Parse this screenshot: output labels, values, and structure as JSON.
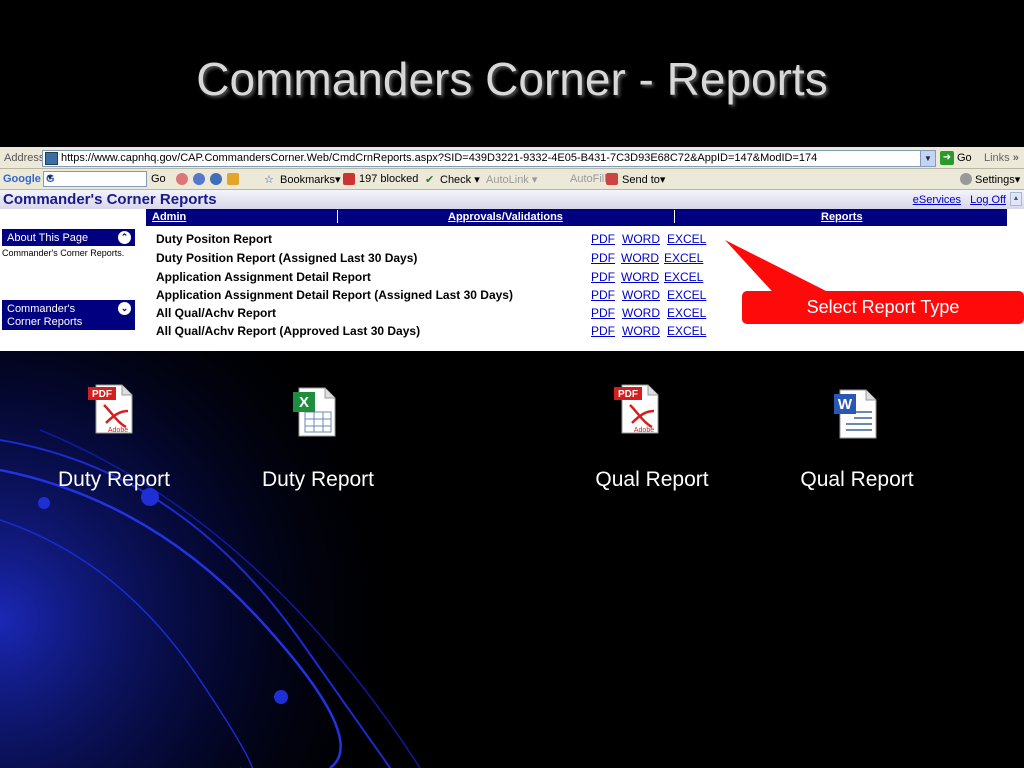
{
  "slide": {
    "title": "Commanders Corner - Reports"
  },
  "browser": {
    "address_label": "Address",
    "url": "https://www.capnhq.gov/CAP.CommandersCorner.Web/CmdCrnReports.aspx?SID=439D3221-9332-4E05-B431-7C3D93E68C72&AppID=147&ModID=174",
    "go_label": "Go",
    "links_label": "Links",
    "more_chevron": "»"
  },
  "toolbar": {
    "google_logo": "Google",
    "google_box": "G",
    "go_label": "Go",
    "bookmarks_label": "Bookmarks",
    "blocked_label": "197 blocked",
    "check_label": "Check",
    "autolink_label": "AutoLink",
    "autofill_label": "AutoFill",
    "sendto_label": "Send to",
    "settings_label": "Settings"
  },
  "app": {
    "title": "Commander's Corner Reports",
    "eservices_label": "eServices",
    "logoff_label": "Log Off"
  },
  "nav": {
    "admin": "Admin",
    "approvals": "Approvals/Validations",
    "reports": "Reports"
  },
  "sidebar": {
    "about_label": "About This Page",
    "note": "Commander's Corner Reports.",
    "menu_line1": "Commander's",
    "menu_line2": "Corner Reports"
  },
  "reports": {
    "pdf_label": "PDF",
    "word_label": "WORD",
    "excel_label": "EXCEL",
    "items": [
      "Duty Positon Report",
      "Duty Position Report (Assigned Last 30 Days)",
      "Application Assignment Detail Report",
      "Application Assignment Detail Report (Assigned Last 30 Days)",
      "All Qual/Achv Report",
      "All Qual/Achv Report (Approved Last 30 Days)"
    ]
  },
  "callout": {
    "text": "Select Report Type"
  },
  "files": [
    {
      "type": "pdf",
      "caption": "Duty Report",
      "badge": "PDF",
      "brand": "Adobe"
    },
    {
      "type": "excel",
      "caption": "Duty Report",
      "badge": "X"
    },
    {
      "type": "pdf",
      "caption": "Qual Report",
      "badge": "PDF",
      "brand": "Adobe"
    },
    {
      "type": "word",
      "caption": "Qual Report",
      "badge": "W"
    }
  ],
  "colors": {
    "navy": "#000080",
    "callout_red": "#ff0a0a",
    "link_blue": "#0000cc",
    "pdf_red": "#d41f1f",
    "excel_green": "#1e8e3e",
    "word_blue": "#2b57b4"
  }
}
